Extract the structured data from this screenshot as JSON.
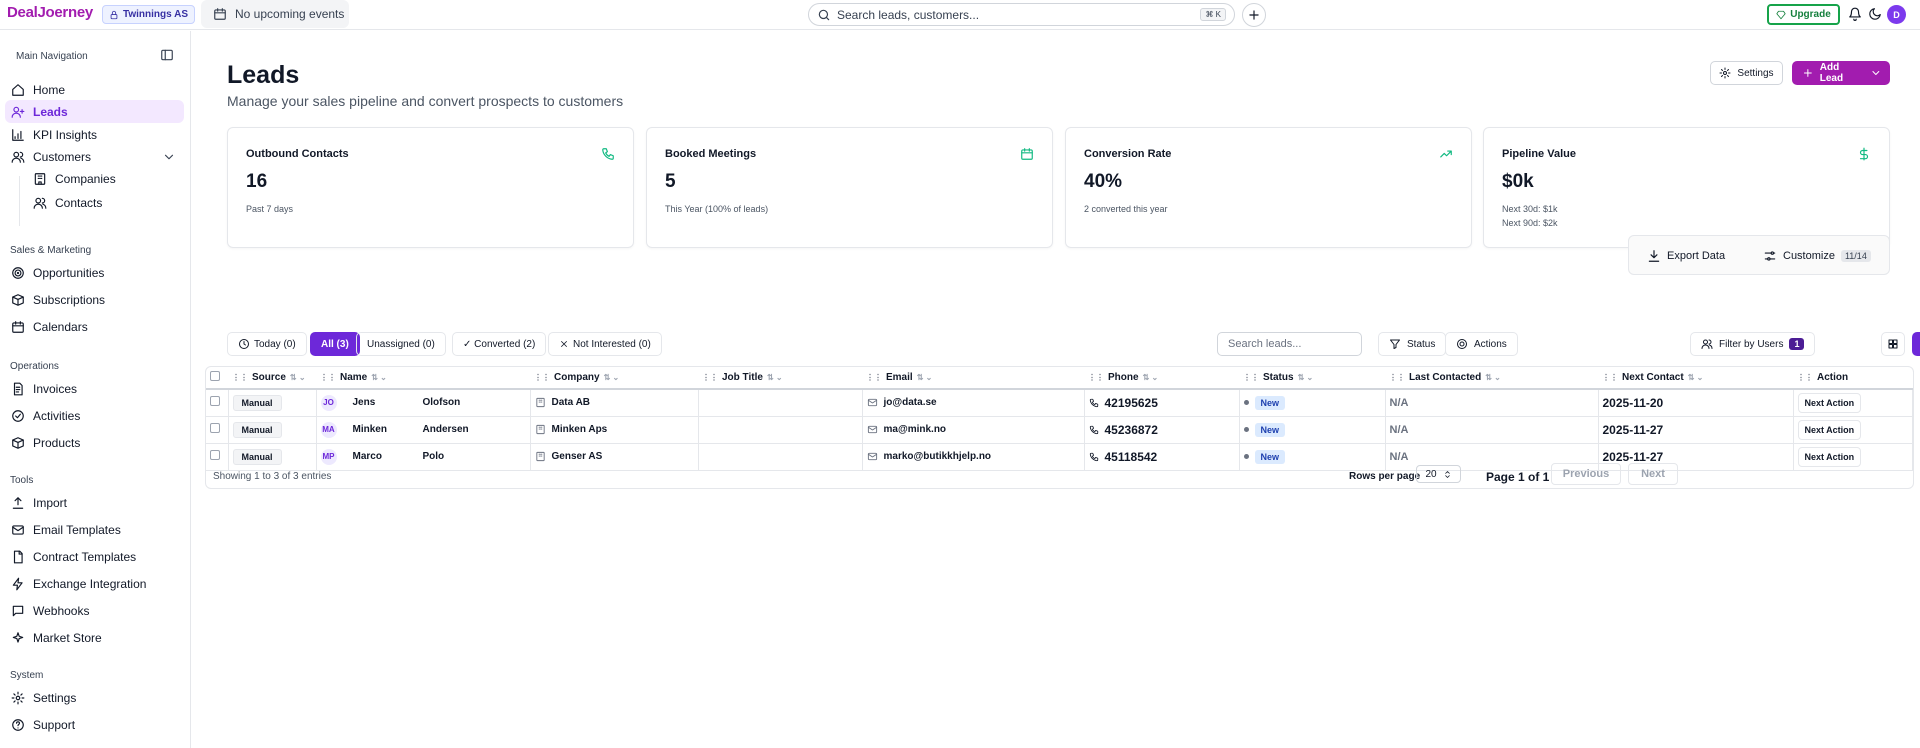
{
  "topbar": {
    "logo": "DealJoerney",
    "org": "Twinnings AS",
    "events": "No upcoming events",
    "search_placeholder": "Search leads, customers...",
    "search_kbd": "⌘ K",
    "upgrade": "Upgrade",
    "avatar": "D"
  },
  "sidebar": {
    "heading": "Main Navigation",
    "items": [
      {
        "label": "Home",
        "icon": "home-icon"
      },
      {
        "label": "Leads",
        "icon": "user-plus-icon",
        "active": true
      },
      {
        "label": "KPI Insights",
        "icon": "chart-icon"
      },
      {
        "label": "Customers",
        "icon": "users-icon"
      },
      {
        "label": "Companies",
        "icon": "building-icon"
      },
      {
        "label": "Contacts",
        "icon": "contacts-icon"
      }
    ],
    "sections": {
      "sales": "Sales & Marketing",
      "operations": "Operations",
      "tools": "Tools",
      "system": "System"
    },
    "sales_items": [
      "Opportunities",
      "Subscriptions",
      "Calendars"
    ],
    "ops_items": [
      "Invoices",
      "Activities",
      "Products"
    ],
    "tools_items": [
      "Import",
      "Email Templates",
      "Contract Templates",
      "Exchange Integration",
      "Webhooks",
      "Market Store"
    ],
    "system_items": [
      "Settings",
      "Support"
    ]
  },
  "header": {
    "title": "Leads",
    "subtitle": "Manage your sales pipeline and convert prospects to customers",
    "settings": "Settings",
    "add_lead": "Add Lead"
  },
  "cards": [
    {
      "title": "Outbound Contacts",
      "value": "16",
      "note1": "Past 7 days",
      "note2": ""
    },
    {
      "title": "Booked Meetings",
      "value": "5",
      "note1": "This Year (100% of leads)",
      "note2": ""
    },
    {
      "title": "Conversion Rate",
      "value": "40%",
      "note1": "2 converted this year",
      "note2": ""
    },
    {
      "title": "Pipeline Value",
      "value": "$0k",
      "note1": "Next 30d: $1k",
      "note2": "Next 90d: $2k"
    }
  ],
  "toolbox": {
    "export": "Export Data",
    "customize": "Customize",
    "count": "11/14"
  },
  "filters": {
    "today": "Today (0)",
    "all": "All (3)",
    "unassigned": "Unassigned (0)",
    "converted": "✓ Converted (2)",
    "not_interested": "Not Interested (0)",
    "search_placeholder": "Search leads...",
    "status": "Status",
    "actions": "Actions",
    "filter_users": "Filter by Users",
    "users_count": "1"
  },
  "table": {
    "columns": [
      "Source",
      "Name",
      "Company",
      "Job Title",
      "Email",
      "Phone",
      "Status",
      "Last Contacted",
      "Next Contact",
      "Action"
    ],
    "rows": [
      {
        "source": "Manual",
        "initials": "JO",
        "first": "Jens",
        "last": "Olofson",
        "company": "Data AB",
        "job": "",
        "email": "jo@data.se",
        "phone": "42195625",
        "status": "New",
        "last_contacted": "N/A",
        "next_contact": "2025-11-20",
        "action": "Next Action"
      },
      {
        "source": "Manual",
        "initials": "MA",
        "first": "Minken",
        "last": "Andersen",
        "company": "Minken Aps",
        "job": "",
        "email": "ma@mink.no",
        "phone": "45236872",
        "status": "New",
        "last_contacted": "N/A",
        "next_contact": "2025-11-27",
        "action": "Next Action"
      },
      {
        "source": "Manual",
        "initials": "MP",
        "first": "Marco",
        "last": "Polo",
        "company": "Genser AS",
        "job": "",
        "email": "marko@butikkhjelp.no",
        "phone": "45118542",
        "status": "New",
        "last_contacted": "N/A",
        "next_contact": "2025-11-27",
        "action": "Next Action"
      }
    ],
    "showing": "Showing 1 to 3 of 3 entries",
    "rows_per_page_label": "Rows per page",
    "rows_per_page": "20",
    "page_of": "Page 1 of 1",
    "prev": "Previous",
    "next": "Next"
  }
}
